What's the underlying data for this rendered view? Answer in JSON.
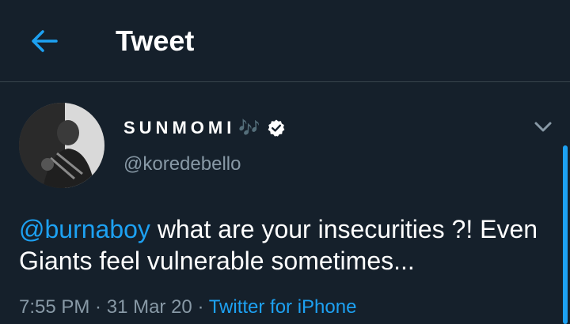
{
  "header": {
    "title": "Tweet"
  },
  "user": {
    "display_name": "SUNMOMI",
    "name_emoji": "🎶",
    "handle": "@koredebello"
  },
  "tweet": {
    "mention": "@burnaboy",
    "text_after_mention": " what are your insecurities ?! Even Giants feel vulnerable sometimes..."
  },
  "meta": {
    "time": "7:55 PM",
    "date": "31 Mar 20",
    "separator": " · ",
    "source": "Twitter for iPhone"
  },
  "colors": {
    "background": "#15202b",
    "accent": "#1da1f2",
    "secondary_text": "#8899a6",
    "divider": "#38444d"
  },
  "icons": [
    "back-arrow-icon",
    "verified-badge-icon",
    "chevron-down-icon"
  ]
}
